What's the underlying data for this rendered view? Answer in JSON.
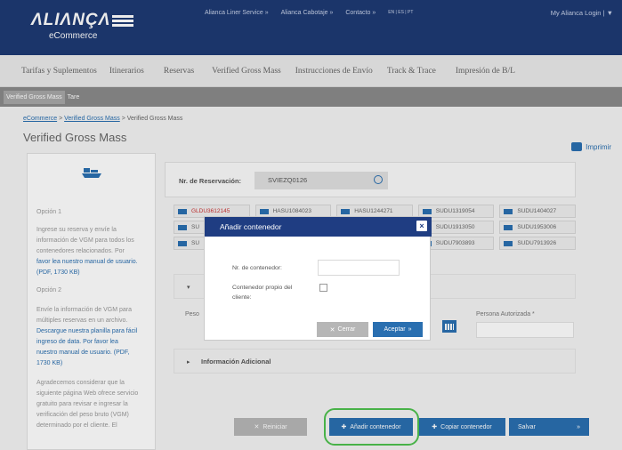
{
  "header": {
    "brand": "ΛLIΛNÇΛ",
    "sub": "eCommerce",
    "links": [
      "Alianca Liner Service »",
      "Alianca Cabotaje »",
      "Contacto »"
    ],
    "lang": "EN | ES | PT",
    "login": "My Alianca Login | ▼"
  },
  "nav": {
    "items": [
      "Tarifas y Suplementos",
      "Itinerarios",
      "Reservas",
      "Verified Gross Mass",
      "Instrucciones de Envío",
      "Track & Trace",
      "Impresión de B/L"
    ]
  },
  "subnav": {
    "tabs": [
      "Verified Gross Mass",
      "Tare"
    ]
  },
  "breadcrumb": {
    "home": "eCommerce",
    "sep": " > ",
    "vgm": "Verified Gross Mass",
    "current": "Verified Gross Mass"
  },
  "page": {
    "title": "Verified Gross Mass",
    "print": "Imprimir"
  },
  "left": {
    "opt1_title": "Opción 1",
    "opt1_line1": "Ingrese su reserva y envíe la",
    "opt1_line2": "información de VGM para todos los",
    "opt1_line3": "contenedores relacionados. Por",
    "opt1_line4": "favor lea nuestro manual de usuario.",
    "opt1_line5": "(PDF, 1730 KB)",
    "opt2_title": "Opción 2",
    "opt2_line1": "Envíe la información de VGM para",
    "opt2_line2": "múltiples reservas en un archivo.",
    "opt2_line3": "Descargue nuestra planilla para fácil",
    "opt2_line4": "ingreso de data. Por favor lea",
    "opt2_line5": "nuestro manual de usuario. (PDF,",
    "opt2_line6": "1730 KB)",
    "note_line1": "Agradecemos considerar que la",
    "note_line2": "siguiente página Web ofrece servicio",
    "note_line3": "gratuito para revisar e ingresar la",
    "note_line4": "verificación del peso bruto (VGM)",
    "note_line5": "determinado por el cliente. El"
  },
  "form": {
    "reservation_label": "Nr. de Reservación:",
    "reservation_value": "SVIEZQ0126",
    "containers_row1": [
      "GLDU3612145",
      "HASU1084023",
      "HASU1244271",
      "SUDU1319054",
      "SUDU1404027"
    ],
    "containers_row2": [
      "SU",
      "",
      "",
      "SUDU1913050",
      "SUDU1953006"
    ],
    "containers_row3": [
      "SU",
      "",
      "",
      "SUDU7903893",
      "SUDU7913926"
    ],
    "peso_label": "Peso",
    "persona_label": "Persona Autorizada *",
    "info_adicional": "Información Adicional"
  },
  "buttons": {
    "reset": "Reiniciar",
    "add": "Añadir contenedor",
    "copy": "Copiar contenedor",
    "save": "Salvar"
  },
  "modal": {
    "title": "Añadir contenedor",
    "close": "×",
    "container_label": "Nr. de contenedor:",
    "own_line1": "Contenedor propio del",
    "own_line2": "cliente:",
    "cancel": "Cerrar",
    "accept": "Aceptar"
  }
}
